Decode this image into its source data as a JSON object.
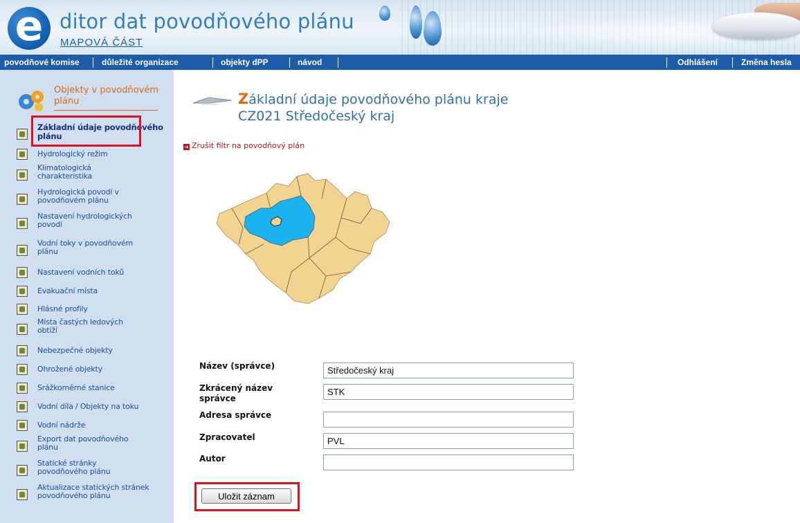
{
  "header": {
    "logo_letter": "e",
    "title": "ditor dat povodňového plánu",
    "subtitle": "MAPOVÁ ČÁST"
  },
  "nav": {
    "left": [
      "povodňové komise",
      "důležité organizace",
      "objekty dPP",
      "návod"
    ],
    "right": [
      "Odhlášení",
      "Změna hesla"
    ]
  },
  "sidebar": {
    "heading": "Objekty v povodňovém plánu",
    "items": [
      {
        "label": "Základní údaje povodňového plánu",
        "active": true
      },
      {
        "label": "Hydrologický režim"
      },
      {
        "label": "Klimatologická charakteristika"
      },
      {
        "label": "Hydrologická povodí v povodňovém plánu"
      },
      {
        "label": "Nastavení hydrologických povodí"
      },
      {
        "label": "Vodní toky v povodňovém plánu"
      },
      {
        "label": "Nastavení vodních toků"
      },
      {
        "label": "Evakuační místa"
      },
      {
        "label": "Hlásné profily"
      },
      {
        "label": "Místa častých ledových obtíží"
      },
      {
        "label": "Nebezpečné objekty"
      },
      {
        "label": "Ohrožené objekty"
      },
      {
        "label": "Srážkoměrné stanice"
      },
      {
        "label": "Vodní díla / Objekty na toku"
      },
      {
        "label": "Vodní nádrže"
      },
      {
        "label": "Export dat povodňového plánu"
      },
      {
        "label": "Statické stránky povodňového plánu"
      },
      {
        "label": "Aktualizace statických stránek povodňového plánu"
      }
    ]
  },
  "main": {
    "title_first_letter": "Z",
    "title_rest": "ákladní údaje povodňového plánu kraje",
    "title_line2": "CZ021 Středočeský kraj",
    "filter_link": "Zrušit filtr na povodňový plán",
    "form": {
      "fields": [
        {
          "label": "Název (správce)",
          "value": "Středočeský kraj"
        },
        {
          "label": "Zkrácený název správce",
          "value": "STK"
        },
        {
          "label": "Adresa správce",
          "value": ""
        },
        {
          "label": "Zpracovatel",
          "value": "PVL"
        },
        {
          "label": "Autor",
          "value": ""
        }
      ],
      "save_label": "Uložit záznam"
    }
  },
  "colors": {
    "nav_bg": "#1c5ca8",
    "sidebar_bg": "#cfdfef",
    "accent_orange": "#e06a10",
    "title_blue": "#2f6fb2",
    "link_red": "#c0141c",
    "highlight_red": "#e01020",
    "map_region": "#f2d38f",
    "map_selected": "#1bb4ef"
  }
}
